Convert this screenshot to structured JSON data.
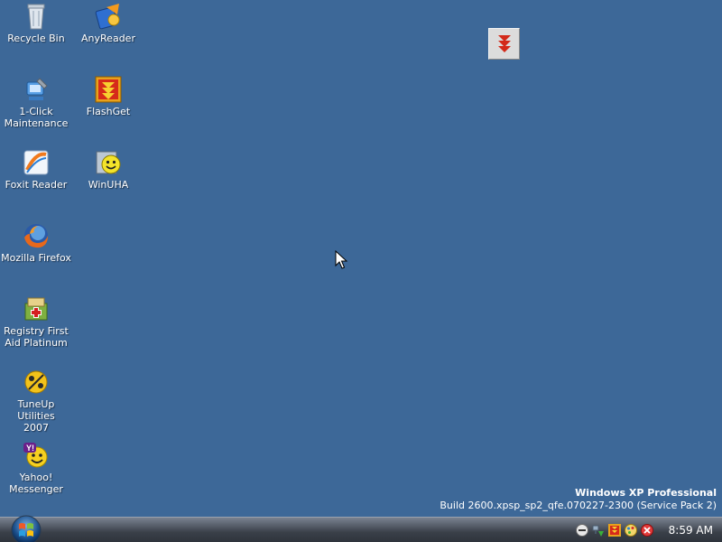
{
  "desktop": {
    "background_color": "#3d6898",
    "icons": [
      {
        "label": "Recycle Bin",
        "icon": "recycle-bin-icon"
      },
      {
        "label": "AnyReader",
        "icon": "anyreader-icon"
      },
      {
        "label": "1-Click\nMaintenance",
        "icon": "maintenance-icon"
      },
      {
        "label": "FlashGet",
        "icon": "flashget-icon"
      },
      {
        "label": "Foxit Reader",
        "icon": "foxit-reader-icon"
      },
      {
        "label": "WinUHA",
        "icon": "winuha-icon"
      },
      {
        "label": "Mozilla Firefox",
        "icon": "firefox-icon"
      },
      {
        "label": "Registry First\nAid Platinum",
        "icon": "registry-first-aid-icon"
      },
      {
        "label": "TuneUp Utilities\n2007",
        "icon": "tuneup-icon"
      },
      {
        "label": "Yahoo!\nMessenger",
        "icon": "yahoo-messenger-icon"
      }
    ]
  },
  "floating_widget": {
    "icon": "flashget-drop-target-icon"
  },
  "watermark": {
    "edition": "Windows XP Professional",
    "build": "Build 2600.xpsp_sp2_qfe.070227-2300 (Service Pack 2)"
  },
  "taskbar": {
    "start_icon": "windows-start-orb-icon",
    "tray_icons": [
      "minus-circle-icon",
      "network-shield-icon",
      "flashget-tray-icon",
      "paint-tray-icon",
      "close-circle-icon"
    ],
    "clock": "8:59 AM"
  }
}
